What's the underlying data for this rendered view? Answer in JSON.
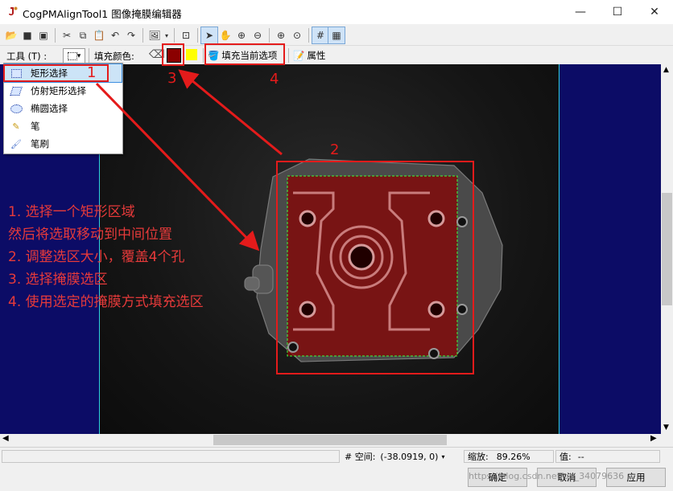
{
  "window": {
    "title": "CogPMAlignTool1 图像掩膜编辑器",
    "minimize": "—",
    "maximize": "☐",
    "close": "✕"
  },
  "toolbar2": {
    "tool_label": "工具 (T) :",
    "fill_color_label": "填充颜色:",
    "fill_button": "填充当前选项",
    "properties_button": "属性",
    "fill_color": "#8b0000",
    "alt_color": "#ffff00"
  },
  "menu": {
    "items": [
      {
        "label": "矩形选择",
        "icon": "rect-select-icon"
      },
      {
        "label": "仿射矩形选择",
        "icon": "affine-rect-select-icon"
      },
      {
        "label": "椭圆选择",
        "icon": "ellipse-select-icon"
      },
      {
        "label": "笔",
        "icon": "pen-icon"
      },
      {
        "label": "笔刷",
        "icon": "brush-icon"
      }
    ]
  },
  "annotations": {
    "num1": "1",
    "num2": "2",
    "num3": "3",
    "num4": "4",
    "lines": [
      "1. 选择一个矩形区域",
      "然后将选取移动到中间位置",
      "2. 调整选区大小，覆盖4个孔",
      "3. 选择掩膜选区",
      "4. 使用选定的掩膜方式填充选区"
    ],
    "color": "#e41b1b"
  },
  "status": {
    "space_label": "# 空间:",
    "coords": "(-38.0919, 0)",
    "zoom_label": "缩放:",
    "zoom": "89.26%",
    "value_label": "值:",
    "value": "--"
  },
  "buttons": {
    "ok": "确定",
    "cancel": "取消",
    "apply": "应用"
  },
  "watermark": "https://blog.csdn.net/qq_34079636"
}
